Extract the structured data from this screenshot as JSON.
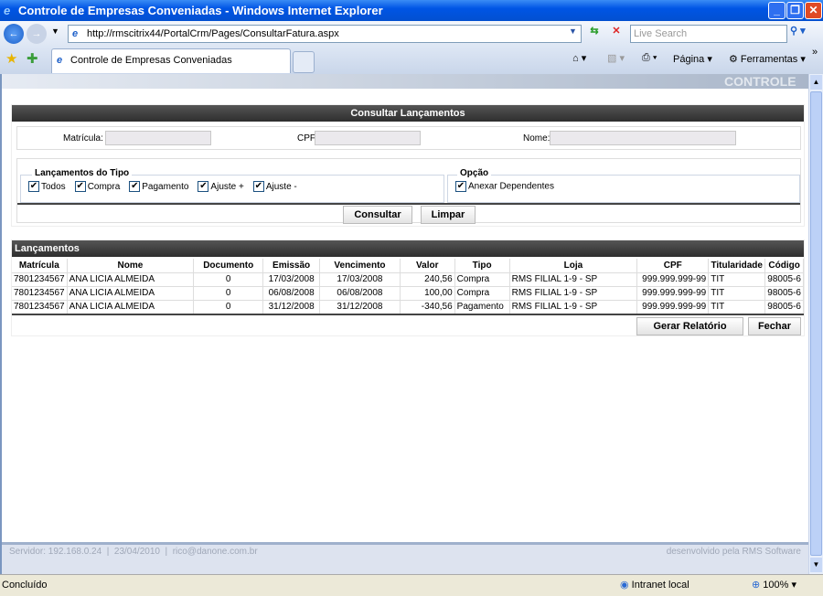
{
  "window": {
    "title": "Controle de Empresas Conveniadas - Windows Internet Explorer"
  },
  "browser": {
    "url": "http://rmscitrix44/PortalCrm/Pages/ConsultarFatura.aspx",
    "search_placeholder": "Live Search",
    "tab_title": "Controle de Empresas Conveniadas",
    "pagina": "Página",
    "ferramentas": "Ferramentas",
    "banner": "CONTROLE"
  },
  "search": {
    "title": "Consultar Lançamentos",
    "matricula_label": "Matrícula:",
    "cpf_label": "CPF:",
    "nome_label": "Nome:",
    "matricula": "",
    "cpf": "",
    "nome": "",
    "tipo_legend": "Lançamentos do Tipo",
    "tipos": [
      {
        "label": "Todos",
        "checked": true
      },
      {
        "label": "Compra",
        "checked": true
      },
      {
        "label": "Pagamento",
        "checked": true
      },
      {
        "label": "Ajuste +",
        "checked": true
      },
      {
        "label": "Ajuste -",
        "checked": true
      }
    ],
    "opcao_legend": "Opção",
    "anexar_label": "Anexar Dependentes",
    "anexar_checked": true,
    "consultar": "Consultar",
    "limpar": "Limpar"
  },
  "results": {
    "title": "Lançamentos",
    "columns": [
      "Matrícula",
      "Nome",
      "Documento",
      "Emissão",
      "Vencimento",
      "Valor",
      "Tipo",
      "Loja",
      "CPF",
      "Titularidade",
      "Código"
    ],
    "rows": [
      [
        "7801234567",
        "ANA LICIA ALMEIDA",
        "0",
        "17/03/2008",
        "17/03/2008",
        "240,56",
        "Compra",
        "RMS FILIAL 1-9 - SP",
        "999.999.999-99",
        "TIT",
        "98005-6"
      ],
      [
        "7801234567",
        "ANA LICIA ALMEIDA",
        "0",
        "06/08/2008",
        "06/08/2008",
        "100,00",
        "Compra",
        "RMS FILIAL 1-9 - SP",
        "999.999.999-99",
        "TIT",
        "98005-6"
      ],
      [
        "7801234567",
        "ANA LICIA ALMEIDA",
        "0",
        "31/12/2008",
        "31/12/2008",
        "-340,56",
        "Pagamento",
        "RMS FILIAL 1-9 - SP",
        "999.999.999-99",
        "TIT",
        "98005-6"
      ]
    ],
    "gerar": "Gerar Relatório",
    "fechar": "Fechar"
  },
  "footer": {
    "servidor": "Servidor: 192.168.0.24",
    "data": "23/04/2010",
    "email": "rico@danone.com.br",
    "credit": "desenvolvido pela RMS Software"
  },
  "status": {
    "text": "Concluído",
    "zone": "Intranet local",
    "zoom": "100%"
  }
}
